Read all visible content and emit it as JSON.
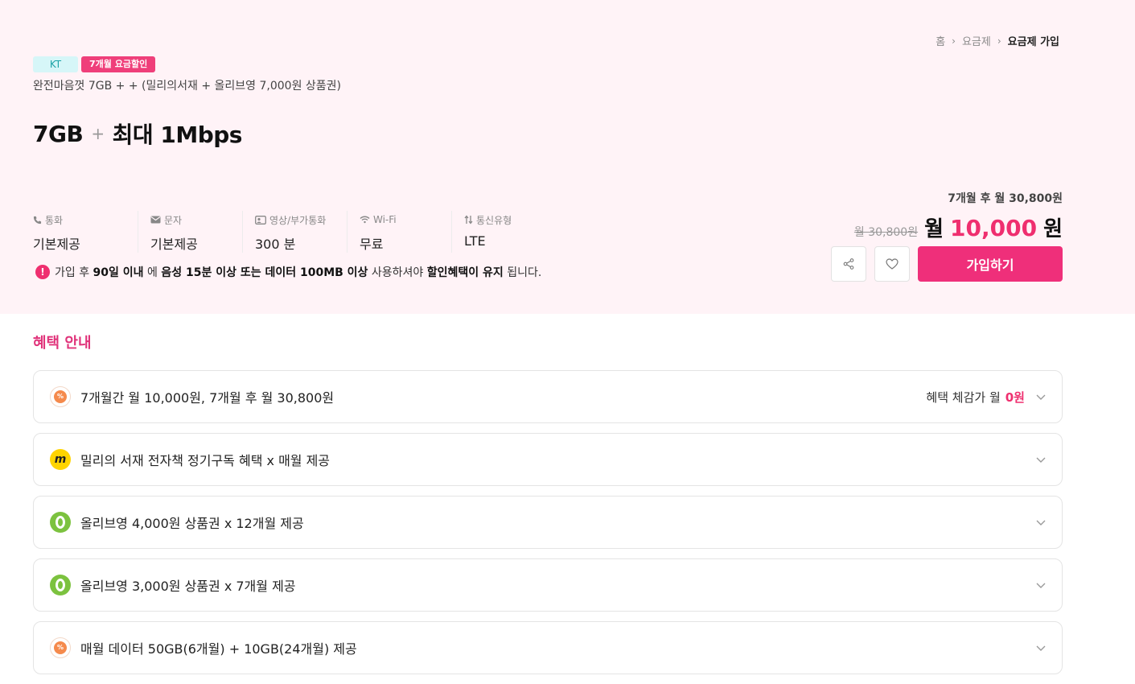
{
  "breadcrumb": {
    "home": "홈",
    "plans": "요금제",
    "current": "요금제 가입"
  },
  "badges": {
    "carrier": "KT",
    "promo": "7개월 요금할인"
  },
  "plan": {
    "name": "완전마음껏 7GB +  + (밀리의서재 + 올리브영 7,000원 상품권)",
    "data": "7GB",
    "plus": "+",
    "speed": "최대 1Mbps"
  },
  "specs": [
    {
      "label": "통화",
      "icon": "phone-icon",
      "value": "기본제공"
    },
    {
      "label": "문자",
      "icon": "mail-icon",
      "value": "기본제공"
    },
    {
      "label": "영상/부가통화",
      "icon": "video-icon",
      "value": "300 분"
    },
    {
      "label": "Wi-Fi",
      "icon": "wifi-icon",
      "value": "무료"
    },
    {
      "label": "통신유형",
      "icon": "transfer-icon",
      "value": "LTE"
    }
  ],
  "notice": {
    "p1": "가입 후 ",
    "b1": "90일 이내",
    "p2": " 에 ",
    "b2": "음성 15분 이상 또는 데이터 100MB 이상",
    "p3": " 사용하셔야 ",
    "b3": "할인혜택이 유지",
    "p4": " 됩니다."
  },
  "price": {
    "after": "7개월 후 월 30,800원",
    "original": "월 30,800원",
    "prefix": "월",
    "amount": "10,000",
    "unit": "원"
  },
  "actions": {
    "join": "가입하기"
  },
  "benefits_title": "혜택 안내",
  "benefits": [
    {
      "text": "7개월간 월 10,000원, 7개월 후 월 30,800원",
      "right_prefix": "혜택 체감가 월 ",
      "right_value": "0원"
    },
    {
      "text": "밀리의 서재 전자책 정기구독 혜택 x 매월 제공"
    },
    {
      "text": "올리브영 4,000원 상품권 x 12개월 제공"
    },
    {
      "text": "올리브영 3,000원 상품권 x 7개월 제공"
    },
    {
      "text": "매월 데이터 50GB(6개월) + 10GB(24개월) 제공"
    }
  ],
  "colors": {
    "accent": "#ef2f7a",
    "hero_bg": "#fff3f7",
    "title": "#e0337a"
  }
}
